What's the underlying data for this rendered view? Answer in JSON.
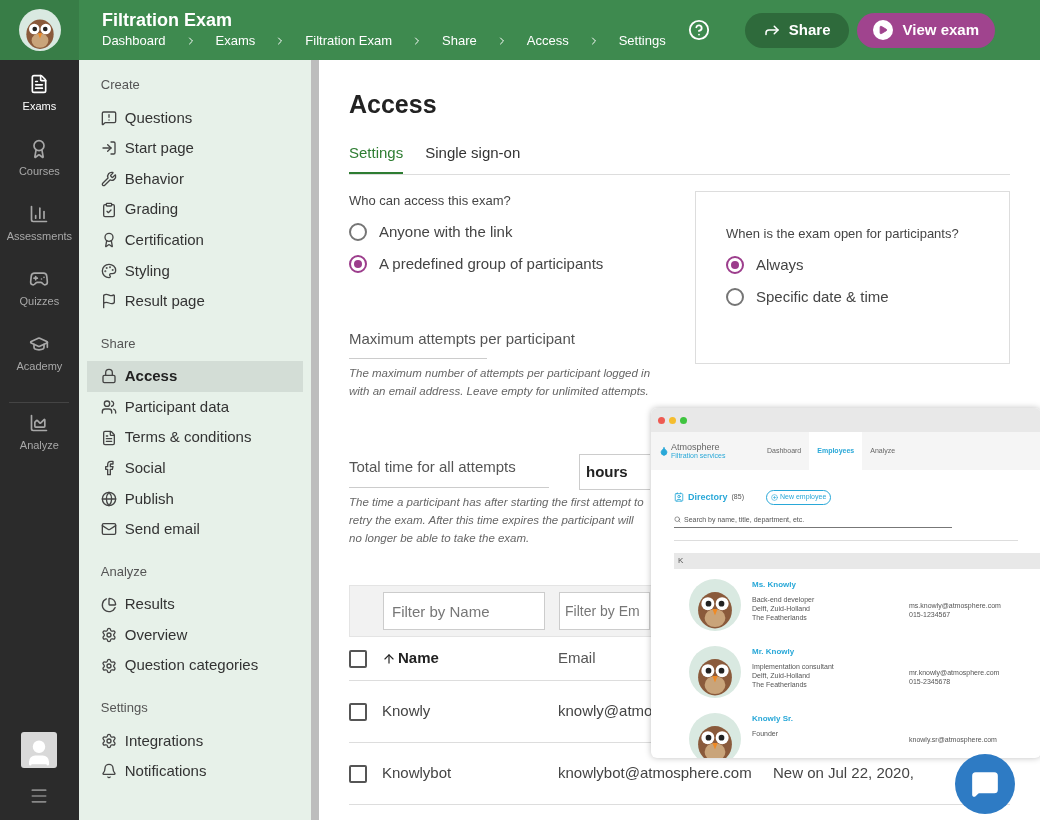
{
  "app": {
    "title": "Filtration Exam",
    "breadcrumbs": [
      "Dashboard",
      "Exams",
      "Filtration Exam",
      "Share",
      "Access",
      "Settings"
    ],
    "actions": [
      {
        "kind": "share",
        "label": "Share"
      },
      {
        "kind": "view",
        "label": "View exam"
      }
    ]
  },
  "rail": {
    "items": [
      {
        "label": "Exams",
        "selected": true
      },
      {
        "label": "Courses",
        "selected": false
      },
      {
        "label": "Assessments",
        "selected": false
      },
      {
        "label": "Quizzes",
        "selected": false
      },
      {
        "label": "Academy",
        "selected": false
      },
      {
        "label": "Analyze",
        "selected": false
      }
    ]
  },
  "sidebar": {
    "sections": [
      {
        "title": "Create",
        "items": [
          {
            "label": "Questions",
            "selected": false
          },
          {
            "label": "Start page",
            "selected": false
          },
          {
            "label": "Behavior",
            "selected": false
          },
          {
            "label": "Grading",
            "selected": false
          },
          {
            "label": "Certification",
            "selected": false
          },
          {
            "label": "Styling",
            "selected": false
          },
          {
            "label": "Result page",
            "selected": false
          }
        ]
      },
      {
        "title": "Share",
        "items": [
          {
            "label": "Access",
            "selected": true
          },
          {
            "label": "Participant data",
            "selected": false
          },
          {
            "label": "Terms & conditions",
            "selected": false
          },
          {
            "label": "Social",
            "selected": false
          },
          {
            "label": "Publish",
            "selected": false
          },
          {
            "label": "Send email",
            "selected": false
          }
        ]
      },
      {
        "title": "Analyze",
        "items": [
          {
            "label": "Results",
            "selected": false
          },
          {
            "label": "Overview",
            "selected": false
          },
          {
            "label": "Question categories",
            "selected": false
          }
        ]
      },
      {
        "title": "Settings",
        "items": [
          {
            "label": "Integrations",
            "selected": false
          },
          {
            "label": "Notifications",
            "selected": false
          }
        ]
      }
    ]
  },
  "page": {
    "title": "Access",
    "tabs": [
      {
        "label": "Settings",
        "selected": true
      },
      {
        "label": "Single sign-on",
        "selected": false
      }
    ],
    "access": {
      "question": "Who can access this exam?",
      "options": [
        {
          "label": "Anyone with the link",
          "selected": false
        },
        {
          "label": "A predefined group of participants",
          "selected": true
        }
      ]
    },
    "max_attempts": {
      "label": "Maximum attempts per participant",
      "help": "The maximum number of attempts per participant logged in with an email address. Leave empty for unlimited attempts."
    },
    "total_time": {
      "label": "Total time for all attempts",
      "unit": "hours",
      "help": "The time a participant has after starting the first attempt to retry the exam. After this time expires the participant will no longer be able to take the exam."
    },
    "schedule": {
      "question": "When is the exam open for participants?",
      "options": [
        {
          "label": "Always",
          "selected": true
        },
        {
          "label": "Specific date & time",
          "selected": false
        }
      ]
    }
  },
  "table": {
    "filters": [
      {
        "placeholder": "Filter by Name"
      },
      {
        "placeholder": "Filter by Em"
      }
    ],
    "select_all_checked": false,
    "columns": [
      {
        "label": "Name",
        "sorted": true
      },
      {
        "label": "Email",
        "sorted": false
      }
    ],
    "rows": [
      {
        "name": "Knowly",
        "email": "knowly@atmo",
        "checked": false
      },
      {
        "name": "Knowlybot",
        "email": "knowlybot@atmosphere.com",
        "column_3": "New on Jul 22, 2020,",
        "checked": false
      }
    ]
  },
  "preview": {
    "brand": "Atmosphere",
    "tagline": "Filtration services",
    "tabs": [
      {
        "label": "Dashboard",
        "selected": false
      },
      {
        "label": "Employees",
        "selected": true
      },
      {
        "label": "Analyze",
        "selected": false
      }
    ],
    "directory": {
      "title": "Directory",
      "count": "(85)",
      "button": "New employee",
      "search_placeholder": "Search by name, title, department, etc.",
      "group": "K"
    },
    "people": [
      {
        "name": "Ms. Knowly",
        "lines": [
          "Back-end developer",
          "Delft, Zuid-Holland",
          "The Featherlands"
        ],
        "contact": [
          "ms.knowly@atmosphere.com",
          "015-1234567"
        ]
      },
      {
        "name": "Mr. Knowly",
        "lines": [
          "Implementation consultant",
          "Delft, Zuid-Holland",
          "The Featherlands"
        ],
        "contact": [
          "mr.knowly@atmosphere.com",
          "015-2345678"
        ]
      },
      {
        "name": "Knowly Sr.",
        "lines": [
          "Founder"
        ],
        "contact": [
          "knowly.sr@atmosphere.com"
        ]
      }
    ]
  }
}
